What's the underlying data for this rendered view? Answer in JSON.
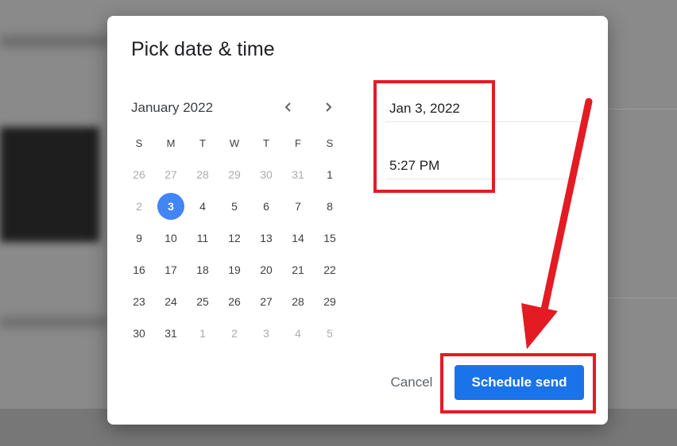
{
  "dialog": {
    "title": "Pick date & time",
    "month_label": "January 2022",
    "weekdays": [
      "S",
      "M",
      "T",
      "W",
      "T",
      "F",
      "S"
    ],
    "weeks": [
      [
        "26",
        "27",
        "28",
        "29",
        "30",
        "31",
        "1"
      ],
      [
        "2",
        "3",
        "4",
        "5",
        "6",
        "7",
        "8"
      ],
      [
        "9",
        "10",
        "11",
        "12",
        "13",
        "14",
        "15"
      ],
      [
        "16",
        "17",
        "18",
        "19",
        "20",
        "21",
        "22"
      ],
      [
        "23",
        "24",
        "25",
        "26",
        "27",
        "28",
        "29"
      ],
      [
        "30",
        "31",
        "1",
        "2",
        "3",
        "4",
        "5"
      ]
    ],
    "selected_day": "3",
    "date_value": "Jan 3, 2022",
    "time_value": "5:27 PM",
    "cancel_label": "Cancel",
    "schedule_label": "Schedule send"
  },
  "icons": {
    "prev": "chevron-left-icon",
    "next": "chevron-right-icon"
  },
  "colors": {
    "accent": "#1a73e8",
    "selected_day_bg": "#4285f4",
    "annotation_red": "#e41b23"
  }
}
